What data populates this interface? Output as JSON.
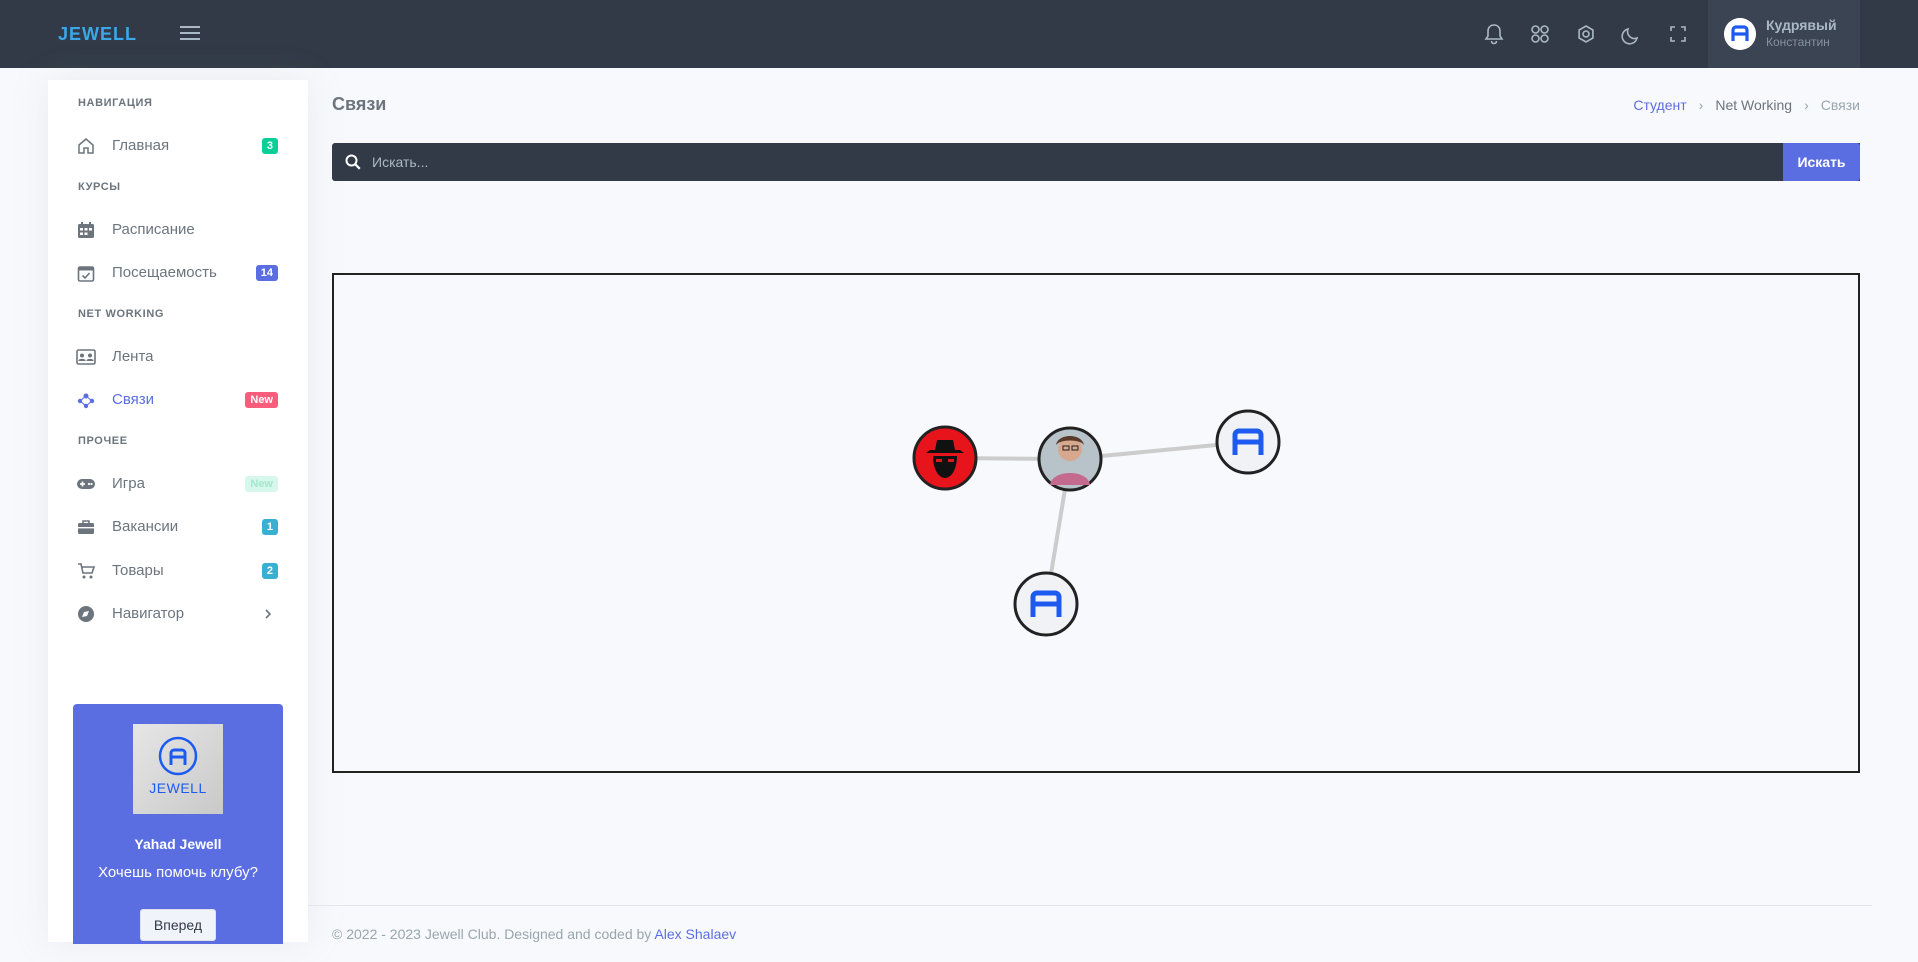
{
  "header": {
    "logo_text": "JEWELL",
    "icons": [
      "bell-icon",
      "apps-icon",
      "gear-icon",
      "moon-icon",
      "fullscreen-icon"
    ],
    "user": {
      "name": "Кудрявый",
      "sub": "Константин"
    }
  },
  "sidebar": {
    "sections": [
      {
        "title": "Навигация"
      },
      {
        "title": "Курсы"
      },
      {
        "title": "Net Working"
      },
      {
        "title": "Прочее"
      }
    ],
    "items": [
      {
        "label": "Главная",
        "badge": "3",
        "icon": "home-icon"
      },
      {
        "label": "Расписание",
        "badge": "",
        "icon": "calendar-icon"
      },
      {
        "label": "Посещаемость",
        "badge": "14",
        "icon": "calendar-check-icon"
      },
      {
        "label": "Лента",
        "badge": "",
        "icon": "contacts-icon"
      },
      {
        "label": "Связи",
        "badge": "New",
        "icon": "network-icon"
      },
      {
        "label": "Игра",
        "badge": "New",
        "icon": "gamepad-icon"
      },
      {
        "label": "Вакансии",
        "badge": "1",
        "icon": "briefcase-icon"
      },
      {
        "label": "Товары",
        "badge": "2",
        "icon": "cart-icon"
      },
      {
        "label": "Навигатор",
        "badge": "",
        "icon": "compass-icon"
      }
    ],
    "promo": {
      "logo_text": "JEWELL",
      "title": "Yahad Jewell",
      "text": "Хочешь помочь клубу?",
      "button": "Вперед"
    }
  },
  "page": {
    "title": "Связи",
    "breadcrumb": [
      "Студент",
      "Net Working",
      "Связи"
    ]
  },
  "search": {
    "placeholder": "Искать...",
    "button": "Искать"
  },
  "graph": {
    "nodes": [
      {
        "id": "n1",
        "avatar": "hat-man-avatar"
      },
      {
        "id": "n2",
        "avatar": "photo-avatar"
      },
      {
        "id": "n3",
        "avatar": "jewell-logo-avatar"
      },
      {
        "id": "n4",
        "avatar": "jewell-logo-avatar"
      }
    ],
    "edges": [
      [
        "n1",
        "n2"
      ],
      [
        "n2",
        "n3"
      ],
      [
        "n2",
        "n4"
      ]
    ]
  },
  "footer": {
    "text": "© 2022 - 2023 Jewell Club. Designed and coded by",
    "author": "Alex Shalaev"
  },
  "colors": {
    "accent": "#5b6ee1",
    "topbar": "#313a46",
    "logo_blue": "#1d5bf0"
  }
}
